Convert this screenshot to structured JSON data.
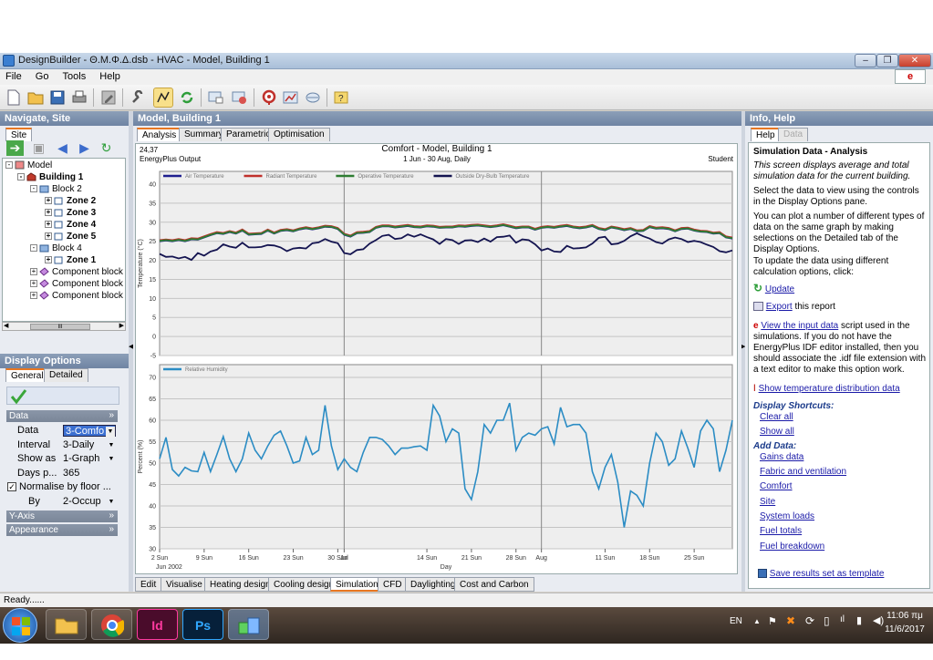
{
  "window": {
    "title": "DesignBuilder - Θ.Μ.Φ.Δ.dsb - HVAC - Model, Building 1"
  },
  "menu": [
    "File",
    "Go",
    "Tools",
    "Help"
  ],
  "left_panel": {
    "title": "Navigate, Site",
    "tab": "Site",
    "tree": [
      {
        "label": "Model",
        "bold": false
      },
      {
        "label": "Building 1",
        "bold": true
      },
      {
        "label": "Block 2",
        "bold": false
      },
      {
        "label": "Zone 2",
        "bold": true
      },
      {
        "label": "Zone 3",
        "bold": true
      },
      {
        "label": "Zone 4",
        "bold": true
      },
      {
        "label": "Zone 5",
        "bold": true
      },
      {
        "label": "Block 4",
        "bold": false
      },
      {
        "label": "Zone 1",
        "bold": true
      },
      {
        "label": "Component block",
        "bold": false
      },
      {
        "label": "Component block",
        "bold": false
      },
      {
        "label": "Component block",
        "bold": false
      }
    ],
    "scroll_grip": "III"
  },
  "display_options": {
    "title": "Display Options",
    "tabs": [
      "General",
      "Detailed"
    ],
    "sections": {
      "data": "Data",
      "yaxis": "Y-Axis",
      "appearance": "Appearance"
    },
    "rows": {
      "data": {
        "label": "Data",
        "value": "3-Comfo"
      },
      "interval": {
        "label": "Interval",
        "value": "3-Daily"
      },
      "showas": {
        "label": "Show as",
        "value": "1-Graph"
      },
      "days": {
        "label": "Days p...",
        "value": "365"
      },
      "normalise": {
        "label": "Normalise by floor ..."
      },
      "by": {
        "label": "By",
        "value": "2-Occup"
      }
    }
  },
  "center": {
    "title": "Model, Building 1",
    "tabs": [
      "Analysis",
      "Summary",
      "Parametric",
      "Optimisation"
    ],
    "header": {
      "version": "24,37",
      "source": "EnergyPlus Output",
      "title": "Comfort - Model, Building 1",
      "subtitle": "1 Jun - 30 Aug, Daily",
      "license": "Student"
    },
    "bottom_tabs": [
      "Edit",
      "Visualise",
      "Heating design",
      "Cooling design",
      "Simulation",
      "CFD",
      "Daylighting",
      "Cost and Carbon"
    ]
  },
  "chart_data": [
    {
      "type": "line",
      "ylabel": "Temperature (°C)",
      "ylim": [
        -5,
        40
      ],
      "yticks": [
        -5,
        0,
        5,
        10,
        15,
        20,
        25,
        30,
        35,
        40
      ],
      "grid": true,
      "legend_position": "top",
      "series": [
        {
          "name": "Air Temperature",
          "color": "#1f1f8f",
          "values": [
            25.0,
            25.2,
            25.0,
            25.3,
            25.0,
            25.5,
            25.4,
            26.0,
            26.6,
            27.1,
            26.9,
            27.4,
            27.0,
            27.8,
            26.7,
            26.8,
            26.9,
            27.8,
            27.0,
            27.7,
            27.9,
            27.6,
            28.1,
            28.4,
            28.1,
            28.4,
            28.8,
            28.7,
            28.2,
            26.7,
            26.2,
            27.1,
            27.2,
            27.4,
            28.5,
            28.9,
            28.9,
            28.6,
            28.8,
            29.0,
            28.7,
            28.6,
            28.9,
            28.8,
            28.5,
            28.6,
            28.6,
            28.9,
            28.8,
            29.0,
            29.1,
            28.9,
            28.7,
            28.9,
            29.2,
            28.8,
            28.4,
            28.6,
            28.6,
            28.0,
            28.5,
            28.7,
            28.5,
            28.8,
            29.0,
            28.6,
            28.4,
            28.6,
            29.0,
            28.2,
            27.9,
            28.6,
            28.3,
            27.9,
            28.2,
            27.6,
            27.7,
            28.7,
            28.3,
            28.4,
            28.2,
            27.6,
            28.2,
            28.3,
            27.8,
            27.5,
            27.4,
            27.0,
            27.1,
            26.0,
            25.7
          ]
        },
        {
          "name": "Radiant Temperature",
          "color": "#c0302b",
          "values": [
            25.3,
            25.5,
            25.3,
            25.6,
            25.3,
            25.8,
            25.7,
            26.3,
            26.9,
            27.4,
            27.2,
            27.7,
            27.3,
            28.1,
            27.0,
            27.1,
            27.2,
            28.1,
            27.3,
            28.0,
            28.2,
            27.9,
            28.4,
            28.7,
            28.4,
            28.7,
            29.1,
            29.0,
            28.5,
            27.0,
            26.5,
            27.4,
            27.5,
            27.7,
            28.8,
            29.2,
            29.2,
            28.9,
            29.1,
            29.3,
            29.0,
            28.9,
            29.2,
            29.1,
            28.8,
            28.9,
            28.9,
            29.2,
            29.1,
            29.3,
            29.4,
            29.2,
            29.0,
            29.2,
            29.5,
            29.1,
            28.7,
            28.9,
            28.9,
            28.3,
            28.8,
            29.0,
            28.8,
            29.1,
            29.3,
            28.9,
            28.7,
            28.9,
            29.3,
            28.5,
            28.2,
            28.9,
            28.6,
            28.2,
            28.5,
            27.9,
            28.0,
            29.0,
            28.6,
            28.7,
            28.5,
            27.9,
            28.5,
            28.6,
            28.1,
            27.8,
            27.7,
            27.3,
            27.4,
            26.3,
            26.0
          ]
        },
        {
          "name": "Operative Temperature",
          "color": "#2e7d32",
          "values": [
            25.1,
            25.3,
            25.1,
            25.4,
            25.1,
            25.6,
            25.5,
            26.1,
            26.7,
            27.2,
            27.0,
            27.5,
            27.1,
            27.9,
            26.8,
            26.9,
            27.0,
            27.9,
            27.1,
            27.8,
            28.0,
            27.7,
            28.2,
            28.5,
            28.2,
            28.5,
            28.9,
            28.8,
            28.3,
            26.8,
            26.3,
            27.2,
            27.3,
            27.5,
            28.6,
            29.0,
            29.0,
            28.7,
            28.9,
            29.1,
            28.8,
            28.7,
            29.0,
            28.9,
            28.6,
            28.7,
            28.7,
            29.0,
            28.9,
            29.1,
            29.2,
            29.0,
            28.8,
            29.0,
            29.3,
            28.9,
            28.5,
            28.7,
            28.7,
            28.1,
            28.6,
            28.8,
            28.6,
            28.9,
            29.1,
            28.7,
            28.5,
            28.7,
            29.1,
            28.3,
            28.0,
            28.7,
            28.4,
            28.0,
            28.3,
            27.7,
            27.8,
            28.8,
            28.4,
            28.5,
            28.3,
            27.7,
            28.3,
            28.4,
            27.9,
            27.6,
            27.5,
            27.1,
            27.2,
            26.1,
            25.8
          ]
        },
        {
          "name": "Outside Dry-Bulb Temperature",
          "color": "#141450",
          "values": [
            21.7,
            20.9,
            21.0,
            20.5,
            20.9,
            20.1,
            21.9,
            21.2,
            22.3,
            22.8,
            24.2,
            23.6,
            23.3,
            24.6,
            23.4,
            23.4,
            23.5,
            24.0,
            23.9,
            23.4,
            22.4,
            23.1,
            23.3,
            23.1,
            24.5,
            24.7,
            25.6,
            24.9,
            24.5,
            21.9,
            21.6,
            22.7,
            22.9,
            24.4,
            25.3,
            26.4,
            26.7,
            25.6,
            25.8,
            26.8,
            26.2,
            26.8,
            26.1,
            25.5,
            24.3,
            25.6,
            25.3,
            24.3,
            25.2,
            25.3,
            24.8,
            25.7,
            24.9,
            26.1,
            26.2,
            26.5,
            24.6,
            25.5,
            25.3,
            24.2,
            22.6,
            23.1,
            22.3,
            22.2,
            23.8,
            23.1,
            23.2,
            23.4,
            24.4,
            25.9,
            26.2,
            24.2,
            24.4,
            25.1,
            26.3,
            27.1,
            26.3,
            25.7,
            24.8,
            24.4,
            25.5,
            26.0,
            25.6,
            24.8,
            25.1,
            24.8,
            24.1,
            23.5,
            22.4,
            22.1,
            22.6
          ]
        }
      ]
    },
    {
      "type": "line",
      "xlabel": "Day",
      "ylabel": "Percent (%)",
      "ylim": [
        30,
        70
      ],
      "yticks": [
        30,
        35,
        40,
        45,
        50,
        55,
        60,
        65,
        70
      ],
      "grid": true,
      "legend_position": "top",
      "x_tick_labels": [
        "2 Sun",
        "9 Sun",
        "16 Sun",
        "23 Sun",
        "30 Sun",
        "Jul",
        "14 Sun",
        "21 Sun",
        "28 Sun",
        "Aug",
        "11 Sun",
        "18 Sun",
        "25 Sun"
      ],
      "x_secondary_label": "Jun 2002",
      "series": [
        {
          "name": "Relative Humidity",
          "color": "#2b8cc4",
          "values": [
            51.0,
            56.0,
            48.5,
            47.0,
            49.0,
            48.2,
            48.0,
            52.5,
            48.0,
            52.0,
            56.2,
            51.0,
            48.0,
            51.0,
            57.0,
            53.0,
            51.0,
            54.0,
            56.5,
            57.5,
            54.0,
            50.0,
            50.5,
            56.0,
            52.0,
            53.0,
            63.5,
            54.0,
            48.5,
            51.0,
            49.0,
            48.0,
            52.5,
            56.0,
            56.0,
            55.5,
            54.0,
            52.0,
            53.5,
            53.5,
            53.8,
            54.0,
            53.0,
            63.5,
            61.0,
            55.0,
            58.0,
            57.0,
            44.0,
            41.5,
            48.0,
            59.0,
            57.0,
            60.0,
            60.0,
            64.0,
            53.0,
            56.0,
            57.0,
            56.5,
            58.0,
            58.5,
            54.5,
            63.0,
            58.5,
            59.0,
            59.0,
            57.0,
            48.0,
            44.0,
            49.0,
            52.0,
            45.5,
            35.0,
            43.5,
            42.5,
            40.0,
            50.0,
            57.0,
            55.0,
            49.5,
            51.0,
            57.5,
            53.5,
            49.0,
            57.5,
            60.0,
            58.0,
            48.0,
            53.0,
            60.0
          ]
        }
      ]
    }
  ],
  "right_panel": {
    "title": "Info, Help",
    "tabs": [
      "Help",
      "Data"
    ],
    "heading": "Simulation Data - Analysis",
    "intro": "This screen displays average and total simulation data for the current building.",
    "p1": "Select the data to view using the controls in the Display Options pane.",
    "p2": "You can plot a number of different types of data on the same graph by making selections on the Detailed tab of the Display Options.",
    "p3": "To update the data using different calculation options, click:",
    "update": "Update",
    "export_link": "Export",
    "export_rest": " this report",
    "view_link": "View the input data",
    "view_rest": " script used in the simulations.  If you do not have the EnergyPlus IDF editor installed, then you should associate the .idf file extension with a text editor to make this option work.",
    "temp_dist": "Show temperature distribution data",
    "shortcuts_title": "Display Shortcuts:",
    "clear_all": "Clear all",
    "show_all": "Show all",
    "add_data_title": "Add Data:",
    "add_data": [
      "Gains data",
      "Fabric and ventilation",
      "Comfort",
      "Site",
      "System loads",
      "Fuel totals",
      "Fuel breakdown"
    ],
    "save_template": "Save results set as template"
  },
  "status": "Ready......",
  "taskbar": {
    "lang": "EN",
    "time": "11:06 πμ",
    "date": "11/6/2017",
    "apps": [
      "Id",
      "Ps"
    ]
  }
}
